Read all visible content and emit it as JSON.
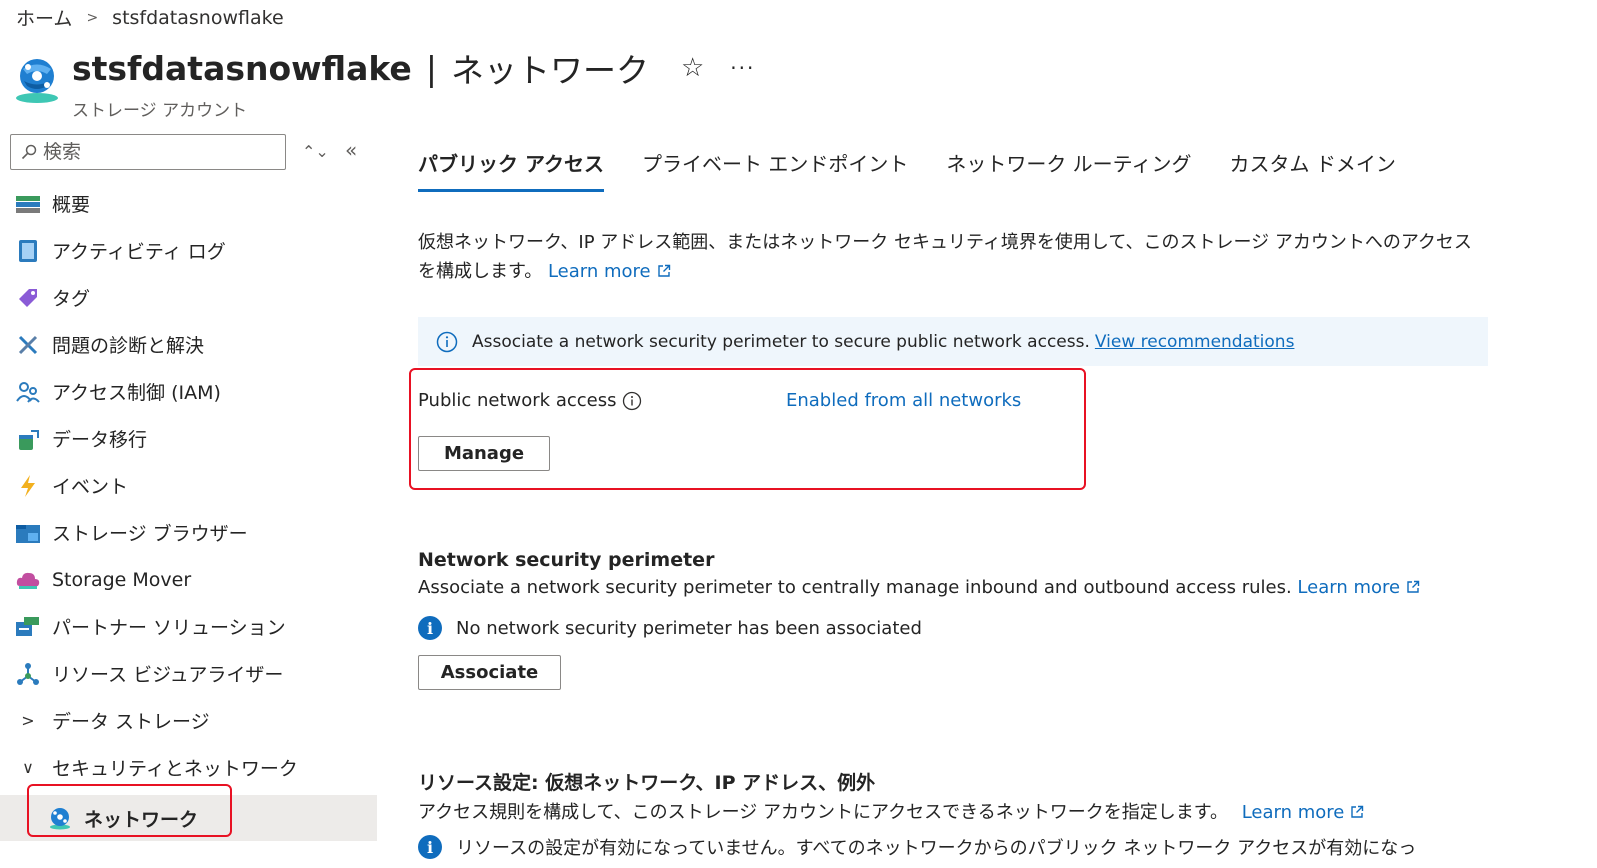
{
  "breadcrumb": {
    "home": "ホーム",
    "separator": ">",
    "current": "stsfdatasnowflake"
  },
  "header": {
    "title": "stsfdatasnowflake",
    "separator": "|",
    "page": "ネットワーク",
    "subtitle": "ストレージ アカウント",
    "star_icon": "☆",
    "more_icon": "···"
  },
  "sidebar": {
    "search_placeholder": "検索",
    "sort_icon": "⌃⌄",
    "collapse_icon": "«",
    "items": [
      {
        "label": "概要",
        "icon": "overview-icon"
      },
      {
        "label": "アクティビティ ログ",
        "icon": "activity-log-icon"
      },
      {
        "label": "タグ",
        "icon": "tag-icon"
      },
      {
        "label": "問題の診断と解決",
        "icon": "diagnose-icon"
      },
      {
        "label": "アクセス制御 (IAM)",
        "icon": "iam-icon"
      },
      {
        "label": "データ移行",
        "icon": "data-migration-icon"
      },
      {
        "label": "イベント",
        "icon": "events-icon"
      },
      {
        "label": "ストレージ ブラウザー",
        "icon": "storage-browser-icon"
      },
      {
        "label": "Storage Mover",
        "icon": "storage-mover-icon"
      },
      {
        "label": "パートナー ソリューション",
        "icon": "partner-solutions-icon"
      },
      {
        "label": "リソース ビジュアライザー",
        "icon": "resource-visualizer-icon"
      }
    ],
    "groups": [
      {
        "label": "データ ストレージ",
        "chevron": ">"
      },
      {
        "label": "セキュリティとネットワーク",
        "chevron": "∨"
      }
    ],
    "active_item": {
      "label": "ネットワーク",
      "icon": "network-icon"
    }
  },
  "tabs": [
    {
      "label": "パブリック アクセス",
      "active": true
    },
    {
      "label": "プライベート エンドポイント",
      "active": false
    },
    {
      "label": "ネットワーク ルーティング",
      "active": false
    },
    {
      "label": "カスタム ドメイン",
      "active": false
    }
  ],
  "public_access": {
    "description": "仮想ネットワーク、IP アドレス範囲、またはネットワーク セキュリティ境界を使用して、このストレージ アカウントへのアクセスを構成します。",
    "learn_more": "Learn more",
    "banner_text": "Associate a network security perimeter to secure public network access.",
    "banner_link": "View recommendations",
    "pna_label": "Public network access",
    "pna_value": "Enabled from all networks",
    "manage_button": "Manage"
  },
  "nsp": {
    "title": "Network security perimeter",
    "description": "Associate a network security perimeter to centrally manage inbound and outbound access rules.",
    "learn_more": "Learn more",
    "info_text": "No network security perimeter has been associated",
    "info_glyph": "i",
    "associate_button": "Associate"
  },
  "resource_settings": {
    "title": "リソース設定: 仮想ネットワーク、IP アドレス、例外",
    "description": "アクセス規則を構成して、このストレージ アカウントにアクセスできるネットワークを指定します。",
    "learn_more": "Learn more",
    "info_text": "リソースの設定が有効になっていません。すべてのネットワークからのパブリック ネットワーク アクセスが有効になっ",
    "info_glyph": "i"
  },
  "colors": {
    "accent": "#0f6cbd",
    "highlight": "#e81123",
    "banner_bg": "#eff6fc"
  }
}
